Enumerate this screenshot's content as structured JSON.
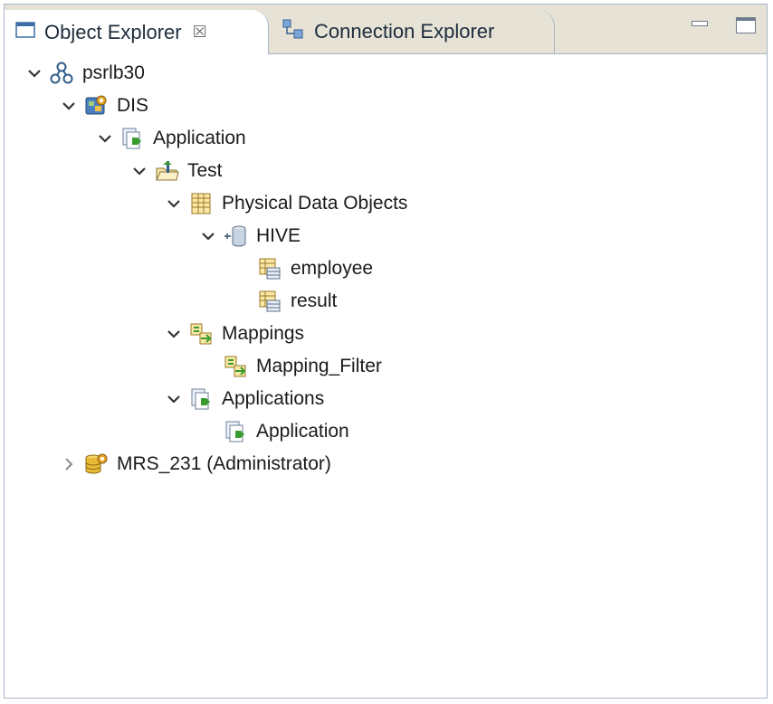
{
  "tabs": [
    {
      "label": "Object Explorer",
      "close_glyph": "☒",
      "icon": "object-explorer-window-icon",
      "active": true
    },
    {
      "label": "Connection Explorer",
      "icon": "connection-explorer-icon",
      "active": false
    }
  ],
  "tree": [
    {
      "label": "psrlb30",
      "icon": "domain-node-icon",
      "expanded": true
    },
    {
      "label": "DIS",
      "icon": "data-integration-service-icon",
      "expanded": true
    },
    {
      "label": "Application",
      "icon": "application-icon",
      "expanded": true
    },
    {
      "label": "Test",
      "icon": "folder-project-icon",
      "expanded": true
    },
    {
      "label": "Physical Data Objects",
      "icon": "physical-data-objects-icon",
      "expanded": true
    },
    {
      "label": "HIVE",
      "icon": "database-connection-icon",
      "expanded": true
    },
    {
      "label": "employee",
      "icon": "table-object-icon"
    },
    {
      "label": "result",
      "icon": "table-object-icon"
    },
    {
      "label": "Mappings",
      "icon": "mappings-icon",
      "expanded": true
    },
    {
      "label": "Mapping_Filter",
      "icon": "mapping-icon"
    },
    {
      "label": "Applications",
      "icon": "application-icon",
      "expanded": true
    },
    {
      "label": "Application",
      "icon": "application-icon"
    },
    {
      "label": "MRS_231 (Administrator)",
      "icon": "model-repository-service-icon",
      "expanded": false
    }
  ],
  "colors": {
    "tab_bar": "#e6e2d6",
    "border": "#a9b6c6",
    "accent_green": "#3a9b2e"
  }
}
